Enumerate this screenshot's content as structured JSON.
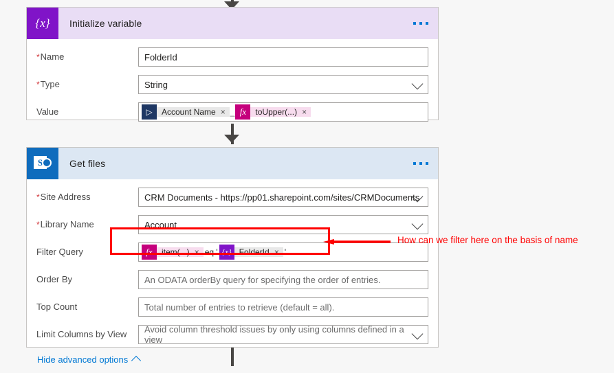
{
  "colors": {
    "page_background": "#f7f7f7",
    "variable_accent": "#8014c8",
    "variable_header": "#e9ddf5",
    "sharepoint_accent": "#0f6cbd",
    "sharepoint_header": "#dce7f3",
    "link": "#0078d4",
    "required_marker": "#d13438",
    "annotation": "#ff0000",
    "connector": "#484644"
  },
  "cards": [
    {
      "id": "initialize-variable",
      "title": "Initialize variable",
      "icon": "variable-braces-icon",
      "icon_glyph": "{x}",
      "menu_label": "•••",
      "fields": [
        {
          "label": "Name",
          "required": true,
          "control": "textbox",
          "value": "FolderId"
        },
        {
          "label": "Type",
          "required": true,
          "control": "dropdown",
          "value": "String"
        },
        {
          "label": "Value",
          "required": false,
          "control": "token-editor",
          "tokens": [
            {
              "kind": "dynamic-content",
              "badge": "flow-logo-icon",
              "badge_glyph": "▷",
              "text": "Account Name",
              "remove": "×",
              "style": "gray"
            },
            {
              "kind": "separator",
              "text": "_"
            },
            {
              "kind": "expression",
              "badge": "fx-icon",
              "badge_glyph": "fx",
              "text": "toUpper(...)",
              "remove": "×",
              "style": "pink"
            }
          ]
        }
      ]
    },
    {
      "id": "get-files",
      "title": "Get files",
      "icon": "sharepoint-icon",
      "icon_glyph": "S",
      "menu_label": "•••",
      "fields": [
        {
          "label": "Site Address",
          "required": true,
          "control": "dropdown",
          "value": "CRM Documents - https://pp01.sharepoint.com/sites/CRMDocuments"
        },
        {
          "label": "Library Name",
          "required": true,
          "control": "dropdown",
          "value": "Account"
        },
        {
          "label": "Filter Query",
          "required": false,
          "control": "token-editor",
          "tokens": [
            {
              "kind": "expression",
              "badge": "fx-icon",
              "badge_glyph": "fx",
              "text": "item(...)",
              "remove": "×",
              "style": "pink"
            },
            {
              "kind": "literal",
              "text": "eq '"
            },
            {
              "kind": "variable",
              "badge": "variable-braces-icon",
              "badge_glyph": "{x}",
              "text": "FolderId",
              "remove": "×",
              "style": "gray"
            },
            {
              "kind": "literal",
              "text": "'"
            }
          ]
        },
        {
          "label": "Order By",
          "required": false,
          "control": "textbox",
          "placeholder": "An ODATA orderBy query for specifying the order of entries."
        },
        {
          "label": "Top Count",
          "required": false,
          "control": "textbox",
          "placeholder": "Total number of entries to retrieve (default = all)."
        },
        {
          "label": "Limit Columns by View",
          "required": false,
          "control": "dropdown",
          "placeholder": "Avoid column threshold issues by only using columns defined in a view"
        }
      ],
      "advanced_link": {
        "label": "Hide advanced options",
        "icon": "chevron-up-icon"
      }
    }
  ],
  "annotation": {
    "text": "How can we filter here on the basis of name",
    "target_field": "Filter Query",
    "arrow": "left-arrow-icon"
  }
}
